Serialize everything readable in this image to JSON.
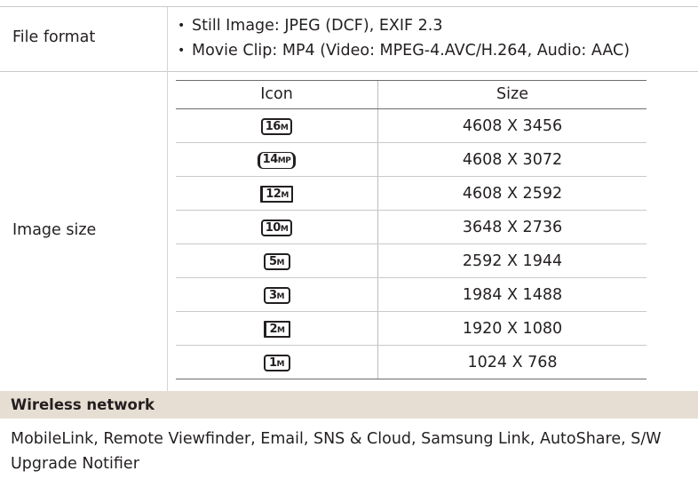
{
  "file_format": {
    "label": "File format",
    "items": [
      "Still Image: JPEG (DCF), EXIF 2.3",
      "Movie Clip: MP4 (Video: MPEG-4.AVC/H.264, Audio: AAC)"
    ]
  },
  "image_size": {
    "label": "Image size",
    "headers": {
      "icon": "Icon",
      "size": "Size"
    },
    "rows": [
      {
        "icon_name": "16m-icon",
        "icon_num": "16",
        "icon_suf": "M",
        "size": "4608 X 3456"
      },
      {
        "icon_name": "14m-p-icon",
        "icon_num": "14",
        "icon_suf": "MP",
        "size": "4608 X 3072"
      },
      {
        "icon_name": "12m-icon",
        "icon_num": "12",
        "icon_suf": "M",
        "size": "4608 X 2592"
      },
      {
        "icon_name": "10m-icon",
        "icon_num": "10",
        "icon_suf": "M",
        "size": "3648 X 2736"
      },
      {
        "icon_name": "5m-icon",
        "icon_num": "5",
        "icon_suf": "M",
        "size": "2592 X 1944"
      },
      {
        "icon_name": "3m-icon",
        "icon_num": "3",
        "icon_suf": "M",
        "size": "1984 X 1488"
      },
      {
        "icon_name": "2m-icon",
        "icon_num": "2",
        "icon_suf": "M",
        "size": "1920 X 1080"
      },
      {
        "icon_name": "1m-icon",
        "icon_num": "1",
        "icon_suf": "M",
        "size": "1024 X 768"
      }
    ]
  },
  "wireless": {
    "title": "Wireless network",
    "body": "MobileLink, Remote Viewfinder, Email, SNS & Cloud, Samsung Link, AutoShare, S/W Upgrade Notifier"
  }
}
